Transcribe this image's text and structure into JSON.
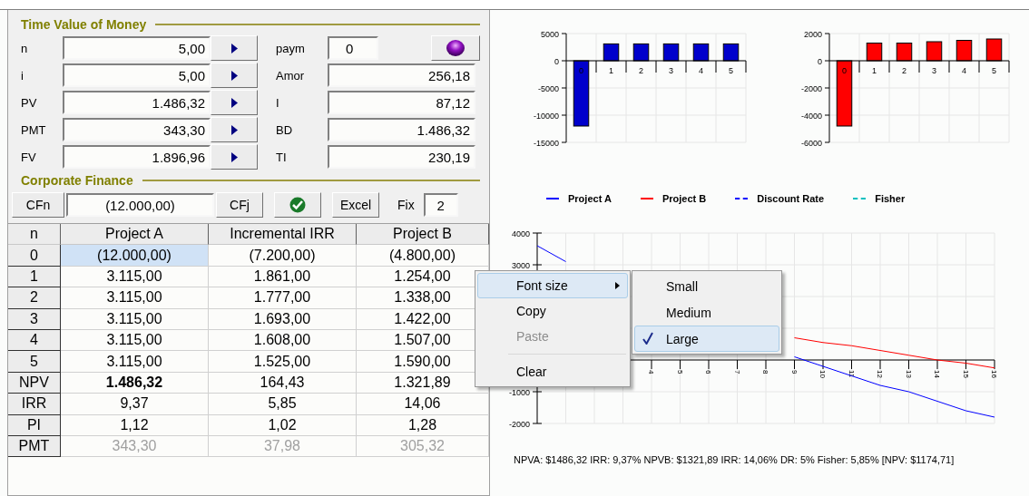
{
  "tvm": {
    "title": "Time Value of Money",
    "left": [
      {
        "label": "n",
        "value": "5,00"
      },
      {
        "label": "i",
        "value": "5,00"
      },
      {
        "label": "PV",
        "value": "1.486,32"
      },
      {
        "label": "PMT",
        "value": "343,30"
      },
      {
        "label": "FV",
        "value": "1.896,96"
      }
    ],
    "right": [
      {
        "label": "paym",
        "value": "0",
        "kind": "short"
      },
      {
        "label": "Amor",
        "value": "256,18",
        "kind": "normal"
      },
      {
        "label": "I",
        "value": "87,12",
        "kind": "normal"
      },
      {
        "label": "BD",
        "value": "1.486,32",
        "kind": "normal"
      },
      {
        "label": "TI",
        "value": "230,19",
        "kind": "normal"
      }
    ]
  },
  "corporate": {
    "title": "Corporate Finance",
    "cfn_button": "CFn",
    "value": "(12.000,00)",
    "cfj_button": "CFj",
    "excel_button": "Excel",
    "fix_label": "Fix",
    "fix_value": "2"
  },
  "table": {
    "columns": [
      "n",
      "Project A",
      "Incremental IRR",
      "Project B"
    ],
    "rows": [
      {
        "muted": false,
        "cells": [
          {
            "text": "0",
            "selected": false,
            "bold": false
          },
          {
            "text": "(12.000,00)",
            "selected": true,
            "bold": false
          },
          {
            "text": "(7.200,00)",
            "selected": false,
            "bold": false
          },
          {
            "text": "(4.800,00)",
            "selected": false,
            "bold": false
          }
        ]
      },
      {
        "muted": false,
        "cells": [
          {
            "text": "1",
            "selected": false,
            "bold": false
          },
          {
            "text": "3.115,00",
            "selected": false,
            "bold": false
          },
          {
            "text": "1.861,00",
            "selected": false,
            "bold": false
          },
          {
            "text": "1.254,00",
            "selected": false,
            "bold": false
          }
        ]
      },
      {
        "muted": false,
        "cells": [
          {
            "text": "2",
            "selected": false,
            "bold": false
          },
          {
            "text": "3.115,00",
            "selected": false,
            "bold": false
          },
          {
            "text": "1.777,00",
            "selected": false,
            "bold": false
          },
          {
            "text": "1.338,00",
            "selected": false,
            "bold": false
          }
        ]
      },
      {
        "muted": false,
        "cells": [
          {
            "text": "3",
            "selected": false,
            "bold": false
          },
          {
            "text": "3.115,00",
            "selected": false,
            "bold": false
          },
          {
            "text": "1.693,00",
            "selected": false,
            "bold": false
          },
          {
            "text": "1.422,00",
            "selected": false,
            "bold": false
          }
        ]
      },
      {
        "muted": false,
        "cells": [
          {
            "text": "4",
            "selected": false,
            "bold": false
          },
          {
            "text": "3.115,00",
            "selected": false,
            "bold": false
          },
          {
            "text": "1.608,00",
            "selected": false,
            "bold": false
          },
          {
            "text": "1.507,00",
            "selected": false,
            "bold": false
          }
        ]
      },
      {
        "muted": false,
        "cells": [
          {
            "text": "5",
            "selected": false,
            "bold": false
          },
          {
            "text": "3.115,00",
            "selected": false,
            "bold": false
          },
          {
            "text": "1.525,00",
            "selected": false,
            "bold": false
          },
          {
            "text": "1.590,00",
            "selected": false,
            "bold": false
          }
        ]
      },
      {
        "muted": false,
        "cells": [
          {
            "text": "NPV",
            "selected": false,
            "bold": false
          },
          {
            "text": "1.486,32",
            "selected": false,
            "bold": true
          },
          {
            "text": "164,43",
            "selected": false,
            "bold": false
          },
          {
            "text": "1.321,89",
            "selected": false,
            "bold": false
          }
        ]
      },
      {
        "muted": false,
        "cells": [
          {
            "text": "IRR",
            "selected": false,
            "bold": false
          },
          {
            "text": "9,37",
            "selected": false,
            "bold": false
          },
          {
            "text": "5,85",
            "selected": false,
            "bold": false
          },
          {
            "text": "14,06",
            "selected": false,
            "bold": false
          }
        ]
      },
      {
        "muted": false,
        "cells": [
          {
            "text": "PI",
            "selected": false,
            "bold": false
          },
          {
            "text": "1,12",
            "selected": false,
            "bold": false
          },
          {
            "text": "1,02",
            "selected": false,
            "bold": false
          },
          {
            "text": "1,28",
            "selected": false,
            "bold": false
          }
        ]
      },
      {
        "muted": true,
        "cells": [
          {
            "text": "PMT",
            "selected": false,
            "bold": false
          },
          {
            "text": "343,30",
            "selected": false,
            "bold": false
          },
          {
            "text": "37,98",
            "selected": false,
            "bold": false
          },
          {
            "text": "305,32",
            "selected": false,
            "bold": false
          }
        ]
      }
    ]
  },
  "bar_chart_a": {
    "chart_data": {
      "type": "bar",
      "grid": true,
      "categories": [
        "0",
        "1",
        "2",
        "3",
        "4",
        "5"
      ],
      "series": [
        {
          "color": "#0000cc",
          "values": [
            -12000,
            3100,
            3100,
            3100,
            3100,
            3100
          ]
        }
      ],
      "ylim": [
        -15000,
        5000
      ],
      "yticks": [
        -15000,
        -10000,
        -5000,
        0,
        5000
      ]
    }
  },
  "bar_chart_b": {
    "chart_data": {
      "type": "bar",
      "grid": true,
      "categories": [
        "0",
        "1",
        "2",
        "3",
        "4",
        "5"
      ],
      "series": [
        {
          "color": "#ff0000",
          "values": [
            -4800,
            1300,
            1300,
            1400,
            1500,
            1600
          ]
        }
      ],
      "ylim": [
        -6000,
        2000
      ],
      "yticks": [
        -6000,
        -4000,
        -2000,
        0,
        2000
      ]
    }
  },
  "npv_chart": {
    "chart_data": {
      "type": "line",
      "grid": true,
      "x": [
        0,
        1,
        2,
        3,
        4,
        5,
        6,
        7,
        8,
        9,
        10,
        11,
        12,
        13,
        14,
        15,
        16
      ],
      "series": [
        {
          "name": "Project A",
          "color": "#0000ff",
          "values": [
            3600,
            3100,
            null,
            null,
            null,
            null,
            null,
            null,
            null,
            100,
            -200,
            -500,
            -800,
            -1000,
            -1300,
            -1600,
            -1800
          ]
        },
        {
          "name": "Project B",
          "color": "#ff0000",
          "values": [
            null,
            null,
            null,
            null,
            null,
            null,
            null,
            null,
            null,
            700,
            550,
            450,
            300,
            150,
            0,
            -100,
            -250
          ]
        }
      ],
      "xlim": [
        0,
        16
      ],
      "ylim": [
        -2000,
        4000
      ],
      "xticks": [
        4,
        5,
        6,
        7,
        8,
        9,
        10,
        11,
        12,
        13,
        14,
        15,
        16
      ],
      "yticks": [
        -2000,
        -1000,
        3000,
        4000
      ]
    },
    "legend": [
      {
        "label": "Discount Rate",
        "color": "#0000ff",
        "kind": "dashed"
      },
      {
        "label": "Fisher",
        "color": "#00c0c0",
        "kind": "dashed"
      }
    ]
  },
  "summary": "NPVA: $1486,32 IRR: 9,37% NPVB: $1321,89 IRR: 14,06% DR: 5% Fisher: 5,85% [NPV: $1174,71]",
  "context_menu": {
    "items": [
      {
        "label": "Font size",
        "kind": "submenu",
        "selected": true,
        "disabled": false
      },
      {
        "label": "Copy",
        "kind": "item",
        "selected": false,
        "disabled": false
      },
      {
        "label": "Paste",
        "kind": "item",
        "selected": false,
        "disabled": true
      },
      {
        "label": "Clear",
        "kind": "separated",
        "selected": false,
        "disabled": false
      }
    ],
    "submenu": [
      {
        "label": "Small",
        "checked": false,
        "selected": false
      },
      {
        "label": "Medium",
        "checked": false,
        "selected": false
      },
      {
        "label": "Large",
        "checked": true,
        "selected": true
      }
    ]
  }
}
